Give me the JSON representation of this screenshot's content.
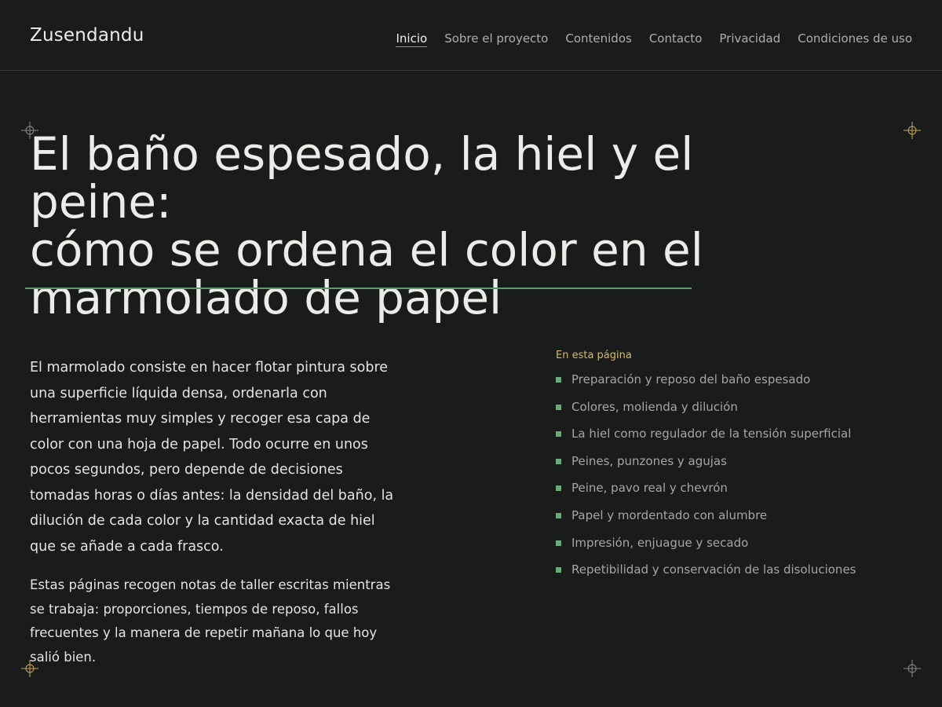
{
  "header": {
    "brand": "Zusendandu",
    "nav": [
      {
        "label": "Inicio",
        "active": true
      },
      {
        "label": "Sobre el proyecto",
        "active": false
      },
      {
        "label": "Contenidos",
        "active": false
      },
      {
        "label": "Contacto",
        "active": false
      },
      {
        "label": "Privacidad",
        "active": false
      },
      {
        "label": "Condiciones de uso",
        "active": false
      }
    ]
  },
  "hero": {
    "title_lines": [
      "El baño espesado, la hiel y el",
      "peine:",
      "cómo se ordena el color en el",
      "marmolado de papel"
    ]
  },
  "intro": {
    "paragraphs": [
      "El marmolado consiste en hacer flotar pintura sobre una superficie líquida densa, ordenarla con herramientas muy simples y recoger esa capa de color con una hoja de papel. Todo ocurre en unos pocos segundos, pero depende de decisiones tomadas horas o días antes: la densidad del baño, la dilución de cada color y la cantidad exacta de hiel que se añade a cada frasco.",
      "Estas páginas recogen notas de taller escritas mientras se trabaja: proporciones, tiempos de reposo, fallos frecuentes y la manera de repetir mañana lo que hoy salió bien."
    ]
  },
  "toc": {
    "title": "En esta página",
    "items": [
      "Preparación y reposo del baño espesado",
      "Colores, molienda y dilución",
      "La hiel como regulador de la tensión superficial",
      "Peines, punzones y agujas",
      "Peine, pavo real y chevrón",
      "Papel y mordentado con alumbre",
      "Impresión, enjuague y secado",
      "Repetibilidad y conservación de las disoluciones"
    ]
  },
  "colors": {
    "background": "#1a1b1b",
    "accent_green": "#6aaa7c",
    "accent_gold": "#d6b96c",
    "crosshair_gold": "#c9a85a",
    "crosshair_gray": "#8a8a86"
  }
}
